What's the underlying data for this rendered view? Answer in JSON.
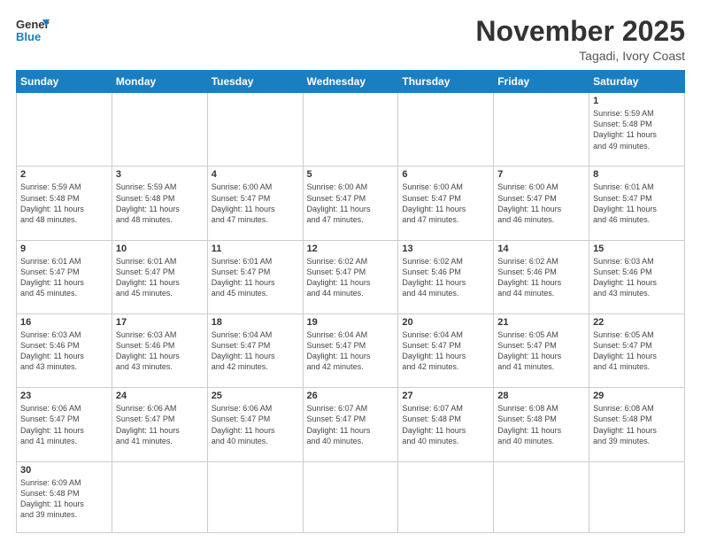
{
  "header": {
    "logo_general": "General",
    "logo_blue": "Blue",
    "month_title": "November 2025",
    "location": "Tagadi, Ivory Coast"
  },
  "weekdays": [
    "Sunday",
    "Monday",
    "Tuesday",
    "Wednesday",
    "Thursday",
    "Friday",
    "Saturday"
  ],
  "weeks": [
    [
      {
        "day": "",
        "info": ""
      },
      {
        "day": "",
        "info": ""
      },
      {
        "day": "",
        "info": ""
      },
      {
        "day": "",
        "info": ""
      },
      {
        "day": "",
        "info": ""
      },
      {
        "day": "",
        "info": ""
      },
      {
        "day": "1",
        "info": "Sunrise: 5:59 AM\nSunset: 5:48 PM\nDaylight: 11 hours\nand 49 minutes."
      }
    ],
    [
      {
        "day": "2",
        "info": "Sunrise: 5:59 AM\nSunset: 5:48 PM\nDaylight: 11 hours\nand 48 minutes."
      },
      {
        "day": "3",
        "info": "Sunrise: 5:59 AM\nSunset: 5:48 PM\nDaylight: 11 hours\nand 48 minutes."
      },
      {
        "day": "4",
        "info": "Sunrise: 6:00 AM\nSunset: 5:47 PM\nDaylight: 11 hours\nand 47 minutes."
      },
      {
        "day": "5",
        "info": "Sunrise: 6:00 AM\nSunset: 5:47 PM\nDaylight: 11 hours\nand 47 minutes."
      },
      {
        "day": "6",
        "info": "Sunrise: 6:00 AM\nSunset: 5:47 PM\nDaylight: 11 hours\nand 47 minutes."
      },
      {
        "day": "7",
        "info": "Sunrise: 6:00 AM\nSunset: 5:47 PM\nDaylight: 11 hours\nand 46 minutes."
      },
      {
        "day": "8",
        "info": "Sunrise: 6:01 AM\nSunset: 5:47 PM\nDaylight: 11 hours\nand 46 minutes."
      }
    ],
    [
      {
        "day": "9",
        "info": "Sunrise: 6:01 AM\nSunset: 5:47 PM\nDaylight: 11 hours\nand 45 minutes."
      },
      {
        "day": "10",
        "info": "Sunrise: 6:01 AM\nSunset: 5:47 PM\nDaylight: 11 hours\nand 45 minutes."
      },
      {
        "day": "11",
        "info": "Sunrise: 6:01 AM\nSunset: 5:47 PM\nDaylight: 11 hours\nand 45 minutes."
      },
      {
        "day": "12",
        "info": "Sunrise: 6:02 AM\nSunset: 5:47 PM\nDaylight: 11 hours\nand 44 minutes."
      },
      {
        "day": "13",
        "info": "Sunrise: 6:02 AM\nSunset: 5:46 PM\nDaylight: 11 hours\nand 44 minutes."
      },
      {
        "day": "14",
        "info": "Sunrise: 6:02 AM\nSunset: 5:46 PM\nDaylight: 11 hours\nand 44 minutes."
      },
      {
        "day": "15",
        "info": "Sunrise: 6:03 AM\nSunset: 5:46 PM\nDaylight: 11 hours\nand 43 minutes."
      }
    ],
    [
      {
        "day": "16",
        "info": "Sunrise: 6:03 AM\nSunset: 5:46 PM\nDaylight: 11 hours\nand 43 minutes."
      },
      {
        "day": "17",
        "info": "Sunrise: 6:03 AM\nSunset: 5:46 PM\nDaylight: 11 hours\nand 43 minutes."
      },
      {
        "day": "18",
        "info": "Sunrise: 6:04 AM\nSunset: 5:47 PM\nDaylight: 11 hours\nand 42 minutes."
      },
      {
        "day": "19",
        "info": "Sunrise: 6:04 AM\nSunset: 5:47 PM\nDaylight: 11 hours\nand 42 minutes."
      },
      {
        "day": "20",
        "info": "Sunrise: 6:04 AM\nSunset: 5:47 PM\nDaylight: 11 hours\nand 42 minutes."
      },
      {
        "day": "21",
        "info": "Sunrise: 6:05 AM\nSunset: 5:47 PM\nDaylight: 11 hours\nand 41 minutes."
      },
      {
        "day": "22",
        "info": "Sunrise: 6:05 AM\nSunset: 5:47 PM\nDaylight: 11 hours\nand 41 minutes."
      }
    ],
    [
      {
        "day": "23",
        "info": "Sunrise: 6:06 AM\nSunset: 5:47 PM\nDaylight: 11 hours\nand 41 minutes."
      },
      {
        "day": "24",
        "info": "Sunrise: 6:06 AM\nSunset: 5:47 PM\nDaylight: 11 hours\nand 41 minutes."
      },
      {
        "day": "25",
        "info": "Sunrise: 6:06 AM\nSunset: 5:47 PM\nDaylight: 11 hours\nand 40 minutes."
      },
      {
        "day": "26",
        "info": "Sunrise: 6:07 AM\nSunset: 5:47 PM\nDaylight: 11 hours\nand 40 minutes."
      },
      {
        "day": "27",
        "info": "Sunrise: 6:07 AM\nSunset: 5:48 PM\nDaylight: 11 hours\nand 40 minutes."
      },
      {
        "day": "28",
        "info": "Sunrise: 6:08 AM\nSunset: 5:48 PM\nDaylight: 11 hours\nand 40 minutes."
      },
      {
        "day": "29",
        "info": "Sunrise: 6:08 AM\nSunset: 5:48 PM\nDaylight: 11 hours\nand 39 minutes."
      }
    ],
    [
      {
        "day": "30",
        "info": "Sunrise: 6:09 AM\nSunset: 5:48 PM\nDaylight: 11 hours\nand 39 minutes."
      },
      {
        "day": "",
        "info": ""
      },
      {
        "day": "",
        "info": ""
      },
      {
        "day": "",
        "info": ""
      },
      {
        "day": "",
        "info": ""
      },
      {
        "day": "",
        "info": ""
      },
      {
        "day": "",
        "info": ""
      }
    ]
  ]
}
